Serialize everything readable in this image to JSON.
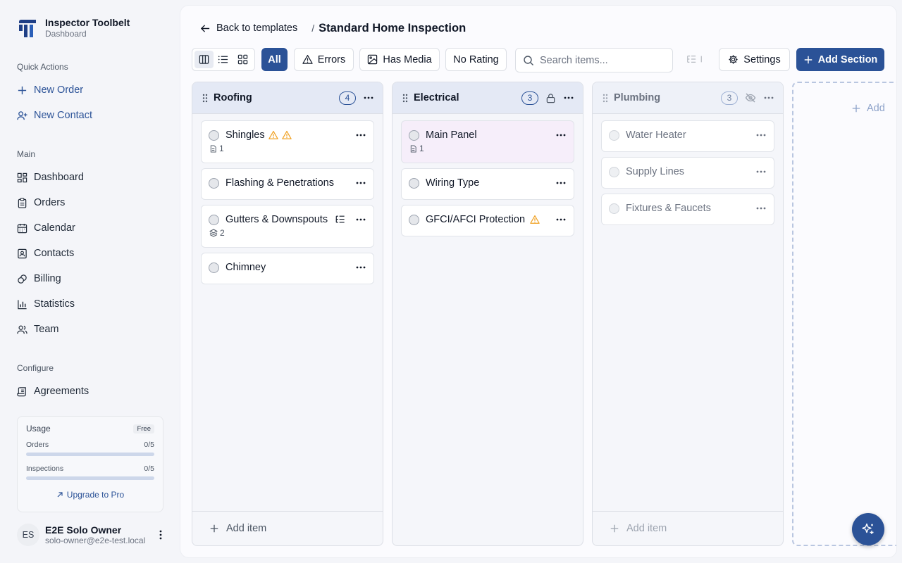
{
  "brand": {
    "title": "Inspector Toolbelt",
    "subtitle": "Dashboard"
  },
  "sidebar": {
    "quick_actions_label": "Quick Actions",
    "quick_actions": [
      {
        "label": "New Order",
        "icon": "plus-icon"
      },
      {
        "label": "New Contact",
        "icon": "user-plus-icon"
      }
    ],
    "main_label": "Main",
    "main_items": [
      {
        "label": "Dashboard",
        "icon": "dashboard-grid-icon"
      },
      {
        "label": "Orders",
        "icon": "clipboard-icon"
      },
      {
        "label": "Calendar",
        "icon": "calendar-icon"
      },
      {
        "label": "Contacts",
        "icon": "contact-card-icon"
      },
      {
        "label": "Billing",
        "icon": "coins-icon"
      },
      {
        "label": "Statistics",
        "icon": "bar-chart-icon"
      },
      {
        "label": "Team",
        "icon": "team-icon"
      }
    ],
    "configure_label": "Configure",
    "configure_items": [
      {
        "label": "Agreements",
        "icon": "scroll-icon"
      }
    ]
  },
  "usage": {
    "title": "Usage",
    "plan": "Free",
    "orders": {
      "label": "Orders",
      "value": "0/5",
      "fraction": 0
    },
    "inspections": {
      "label": "Inspections",
      "value": "0/5",
      "fraction": 0
    },
    "upgrade_label": "Upgrade to Pro"
  },
  "user": {
    "initials": "ES",
    "name": "E2E Solo Owner",
    "email": "solo-owner@e2e-test.local"
  },
  "header": {
    "back_label": "Back to templates",
    "separator": "/",
    "title": "Standard Home Inspection"
  },
  "toolbar": {
    "view_modes": [
      "columns-view-icon",
      "list-view-icon",
      "grid-view-icon"
    ],
    "active_view": 0,
    "filters": {
      "all": "All",
      "errors": "Errors",
      "has_media": "Has Media",
      "no_rating": "No Rating"
    },
    "active_filter": "All",
    "search_placeholder": "Search items...",
    "settings_label": "Settings",
    "add_section_label": "Add Section"
  },
  "columns": [
    {
      "title": "Roofing",
      "count": "4",
      "locked": false,
      "hidden": false,
      "items": [
        {
          "name": "Shingles",
          "warnings": 2,
          "meta": {
            "icon": "document-icon",
            "value": "1"
          }
        },
        {
          "name": "Flashing & Penetrations"
        },
        {
          "name": "Gutters & Downspouts",
          "list_icon": true,
          "meta": {
            "icon": "layers-icon",
            "value": "2"
          }
        },
        {
          "name": "Chimney"
        }
      ],
      "add_label": "Add item"
    },
    {
      "title": "Electrical",
      "count": "3",
      "locked": true,
      "hidden": false,
      "items": [
        {
          "name": "Main Panel",
          "highlight": true,
          "meta": {
            "icon": "document-icon",
            "value": "1"
          }
        },
        {
          "name": "Wiring Type"
        },
        {
          "name": "GFCI/AFCI Protection",
          "warnings": 1
        }
      ],
      "add_label": "Add item"
    },
    {
      "title": "Plumbing",
      "count": "3",
      "locked": false,
      "hidden": true,
      "items": [
        {
          "name": "Water Heater"
        },
        {
          "name": "Supply Lines"
        },
        {
          "name": "Fixtures & Faucets"
        }
      ],
      "add_label": "Add item"
    }
  ],
  "add_column_label": "Add",
  "colors": {
    "primary": "#2b5297",
    "warning": "#f0a020",
    "highlight_card": "#f6eefa"
  }
}
